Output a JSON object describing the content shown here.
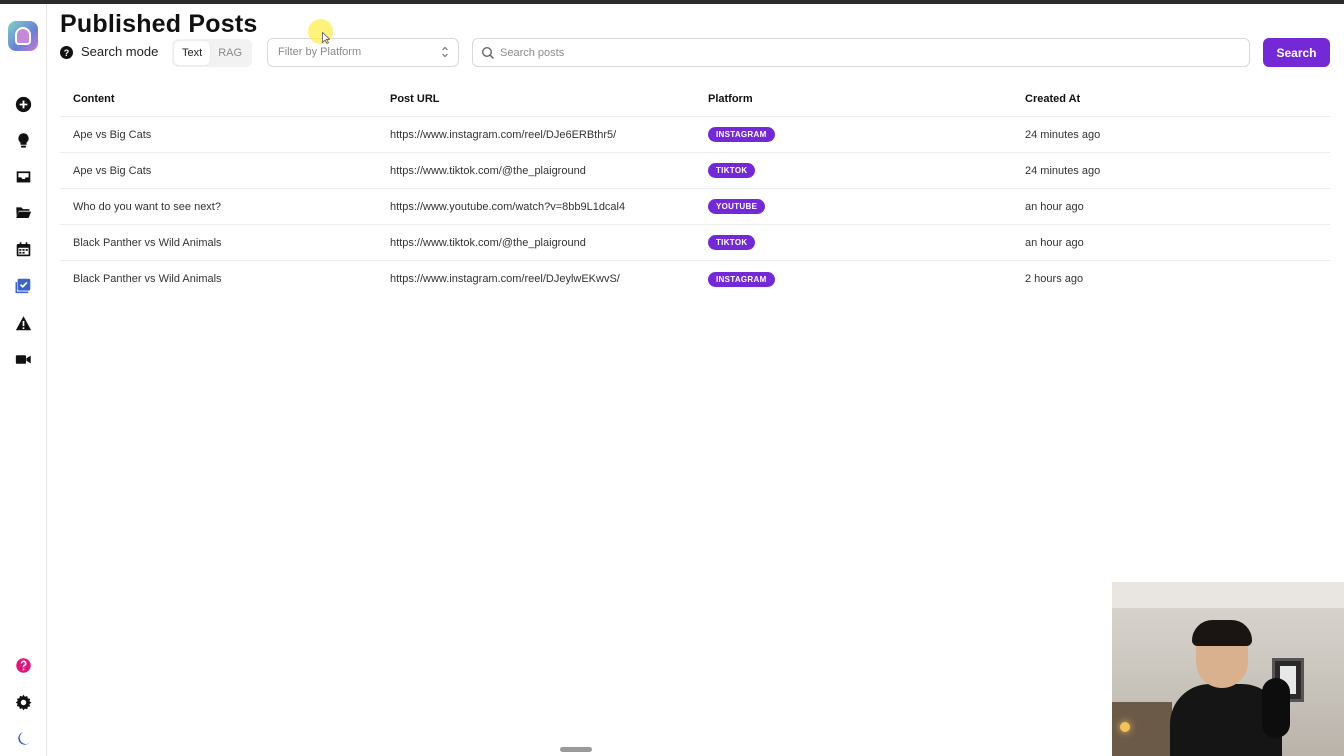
{
  "app": {
    "page_title": "Published Posts"
  },
  "sidebar": {
    "items": [
      {
        "name": "add",
        "icon": "plus-circle-icon"
      },
      {
        "name": "ideas",
        "icon": "lightbulb-icon"
      },
      {
        "name": "inbox",
        "icon": "inbox-icon"
      },
      {
        "name": "folder",
        "icon": "folder-open-icon"
      },
      {
        "name": "calendar",
        "icon": "calendar-icon"
      },
      {
        "name": "published",
        "icon": "check-square-icon",
        "active": true
      },
      {
        "name": "alerts",
        "icon": "warning-icon"
      },
      {
        "name": "video",
        "icon": "video-camera-icon"
      }
    ],
    "bottom_items": [
      {
        "name": "help",
        "icon": "help-circle-icon"
      },
      {
        "name": "settings",
        "icon": "gear-icon"
      },
      {
        "name": "theme",
        "icon": "moon-icon"
      }
    ]
  },
  "toolbar": {
    "search_mode_label": "Search mode",
    "mode_options": [
      "Text",
      "RAG"
    ],
    "mode_selected": "Text",
    "platform_filter_placeholder": "Filter by Platform",
    "search_placeholder": "Search posts",
    "search_value": "",
    "search_button_label": "Search"
  },
  "table": {
    "columns": [
      "Content",
      "Post URL",
      "Platform",
      "Created At"
    ],
    "rows": [
      {
        "content": "Ape vs Big Cats",
        "url": "https://www.instagram.com/reel/DJe6ERBthr5/",
        "platform": "INSTAGRAM",
        "created": "24 minutes ago"
      },
      {
        "content": "Ape vs Big Cats",
        "url": "https://www.tiktok.com/@the_plaiground",
        "platform": "TIKTOK",
        "created": "24 minutes ago"
      },
      {
        "content": "Who do you want to see next?",
        "url": "https://www.youtube.com/watch?v=8bb9L1dcal4",
        "platform": "YOUTUBE",
        "created": "an hour ago"
      },
      {
        "content": "Black Panther vs Wild Animals",
        "url": "https://www.tiktok.com/@the_plaiground",
        "platform": "TIKTOK",
        "created": "an hour ago"
      },
      {
        "content": "Black Panther vs Wild Animals",
        "url": "https://www.instagram.com/reel/DJeylwEKwvS/",
        "platform": "INSTAGRAM",
        "created": "2 hours ago"
      }
    ]
  },
  "colors": {
    "accent": "#7429d6",
    "help_icon": "#e0157a",
    "active_sidebar": "#3b63c9"
  }
}
